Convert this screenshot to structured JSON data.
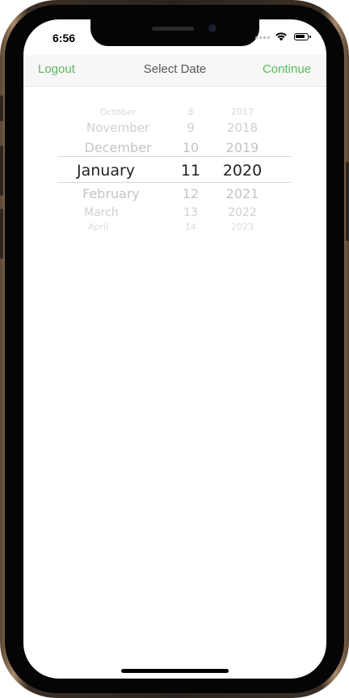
{
  "status_bar": {
    "time": "6:56"
  },
  "navbar": {
    "left_button": "Logout",
    "title": "Select Date",
    "right_button": "Continue",
    "accent_color": "#5cb85c"
  },
  "picker": {
    "months": [
      "October",
      "November",
      "December",
      "January",
      "February",
      "March",
      "April"
    ],
    "days": [
      "8",
      "9",
      "10",
      "11",
      "12",
      "13",
      "14"
    ],
    "years": [
      "2017",
      "2018",
      "2019",
      "2020",
      "2021",
      "2022",
      "2023"
    ],
    "selected": {
      "month": "January",
      "day": "11",
      "year": "2020"
    }
  },
  "icons": [
    "wifi-icon",
    "battery-icon",
    "cellular-signal-icon"
  ]
}
